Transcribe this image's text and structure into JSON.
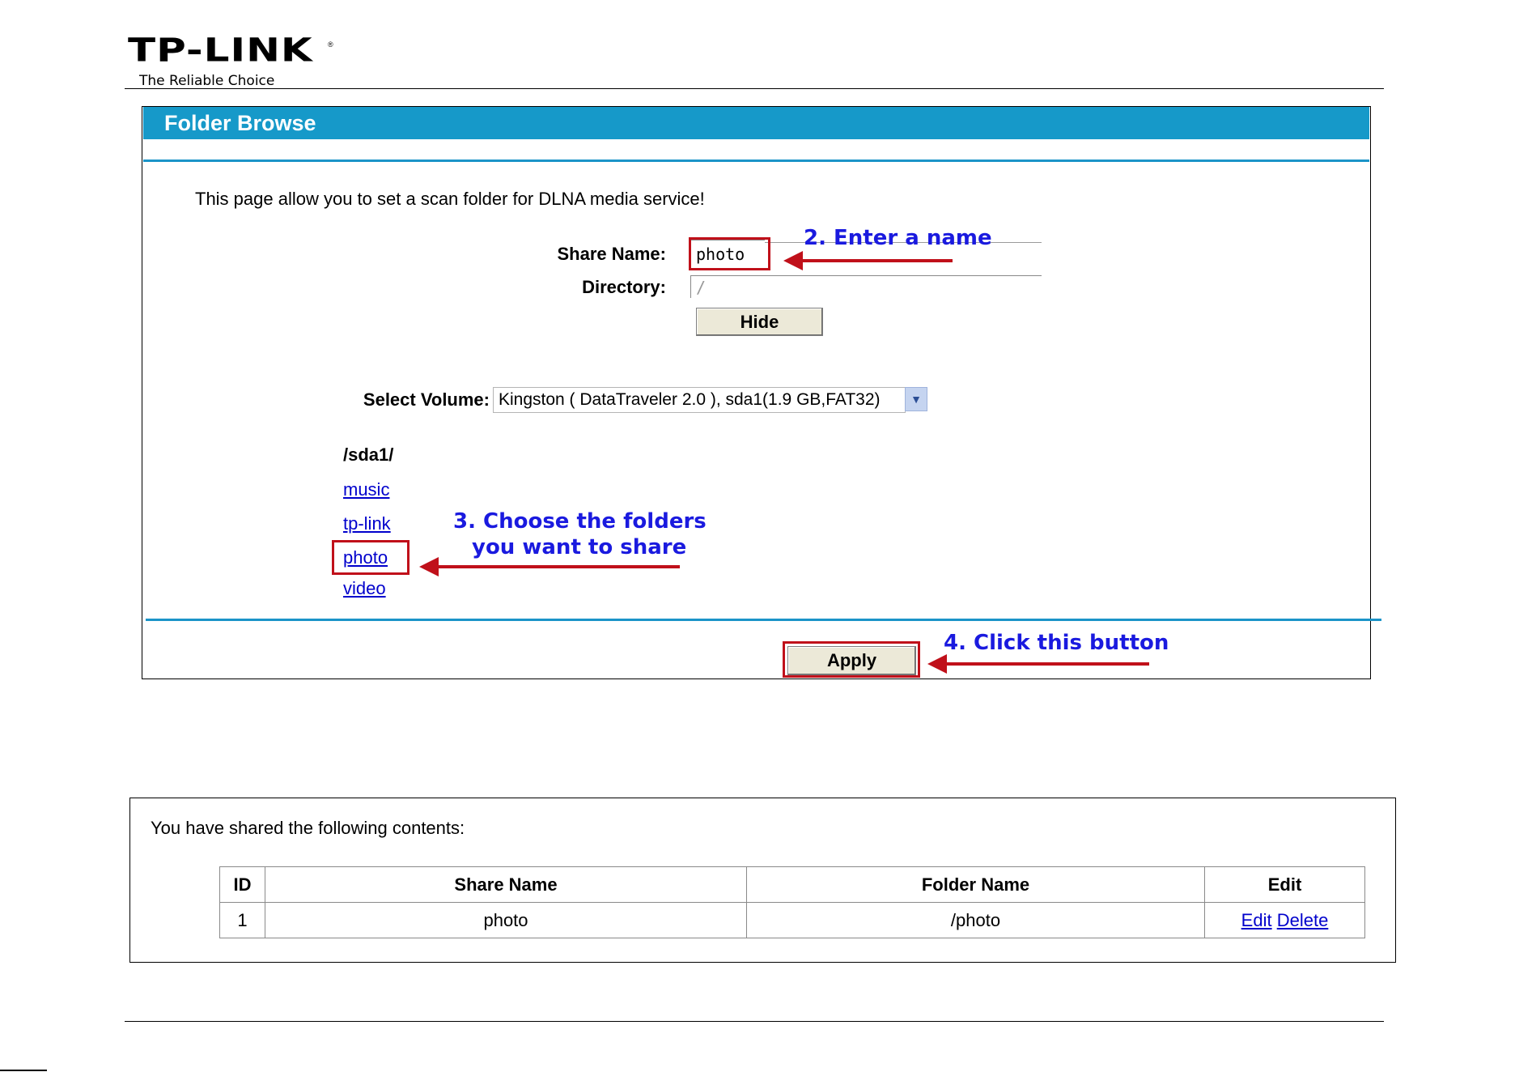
{
  "header": {
    "logo_text": "TP-LINK",
    "logo_mark": "®",
    "tagline": "The Reliable Choice"
  },
  "folder_browse": {
    "title": "Folder Browse",
    "intro": "This page allow you to set a scan folder for DLNA media service!",
    "share_name_label": "Share Name:",
    "share_name_value": "photo",
    "directory_label": "Directory:",
    "directory_value": "/",
    "hide_button": "Hide",
    "select_volume_label": "Select Volume:",
    "select_volume_value": "Kingston  ( DataTraveler 2.0 ), sda1(1.9 GB,FAT32)",
    "current_path": "/sda1/",
    "folders": [
      "music",
      "tp-link",
      "photo",
      "video"
    ],
    "apply_button": "Apply"
  },
  "annotations": {
    "step2": "2. Enter a name",
    "step3_line1": "3. Choose the folders",
    "step3_line2": "you want to share",
    "step4": "4. Click this button",
    "color": "#c0101a",
    "text_color": "#1a1adf"
  },
  "shared_contents": {
    "intro": "You have shared the following contents:",
    "columns": [
      "ID",
      "Share Name",
      "Folder Name",
      "Edit"
    ],
    "rows": [
      {
        "id": "1",
        "share_name": "photo",
        "folder_name": "/photo",
        "edit_label": "Edit",
        "delete_label": "Delete"
      }
    ]
  },
  "colors": {
    "title_bar": "#1699c9",
    "link": "#0000cc"
  }
}
